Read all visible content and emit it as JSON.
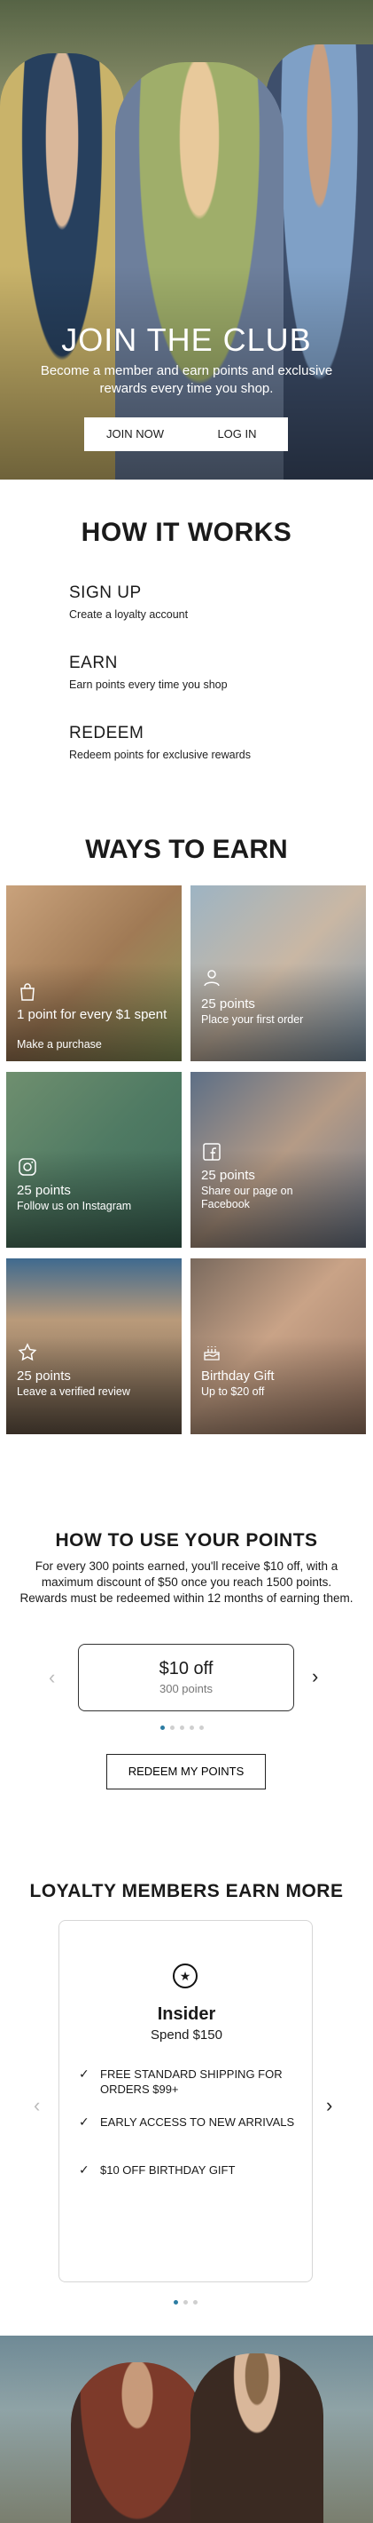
{
  "hero": {
    "title": "JOIN THE CLUB",
    "subtitle": "Become a member and earn points and exclusive rewards every time you shop.",
    "join_label": "JOIN NOW",
    "login_label": "LOG IN"
  },
  "how_it_works": {
    "title": "HOW IT WORKS",
    "steps": [
      {
        "title": "SIGN UP",
        "desc": "Create a loyalty account"
      },
      {
        "title": "EARN",
        "desc": "Earn points every time you shop"
      },
      {
        "title": "REDEEM",
        "desc": "Redeem points for exclusive rewards"
      }
    ]
  },
  "ways_to_earn": {
    "title": "WAYS TO EARN",
    "tiles": [
      {
        "icon": "shopping-bag-icon",
        "points": "1 point for every $1 spent",
        "desc": "Make a purchase"
      },
      {
        "icon": "user-icon",
        "points": "25 points",
        "desc": "Place your first order"
      },
      {
        "icon": "instagram-icon",
        "points": "25 points",
        "desc": "Follow us on Instagram"
      },
      {
        "icon": "facebook-icon",
        "points": "25 points",
        "desc": "Share our page on Facebook"
      },
      {
        "icon": "star-icon",
        "points": "25 points",
        "desc": "Leave a verified review"
      },
      {
        "icon": "birthday-cake-icon",
        "points": "Birthday Gift",
        "desc": "Up to $20 off"
      }
    ]
  },
  "use_points": {
    "title": "HOW TO USE YOUR POINTS",
    "desc": "For every 300 points earned, you'll receive $10 off, with a maximum discount of $50 once you reach 1500 points. Rewards must be redeemed within 12 months of earning them.",
    "card_value": "$10 off",
    "card_points": "300 points",
    "redeem_label": "REDEEM MY POINTS",
    "dot_count": 5,
    "active_dot": 0
  },
  "loyalty": {
    "title": "LOYALTY MEMBERS EARN MORE",
    "tier": "Insider",
    "spend": "Spend $150",
    "perks": [
      "FREE STANDARD SHIPPING FOR ORDERS $99+",
      "EARLY ACCESS TO NEW ARRIVALS",
      "$10 OFF BIRTHDAY GIFT"
    ],
    "dot_count": 3,
    "active_dot": 0
  },
  "colors": {
    "accent_dot": "#2c7ca2",
    "text": "#1a1a1a"
  }
}
